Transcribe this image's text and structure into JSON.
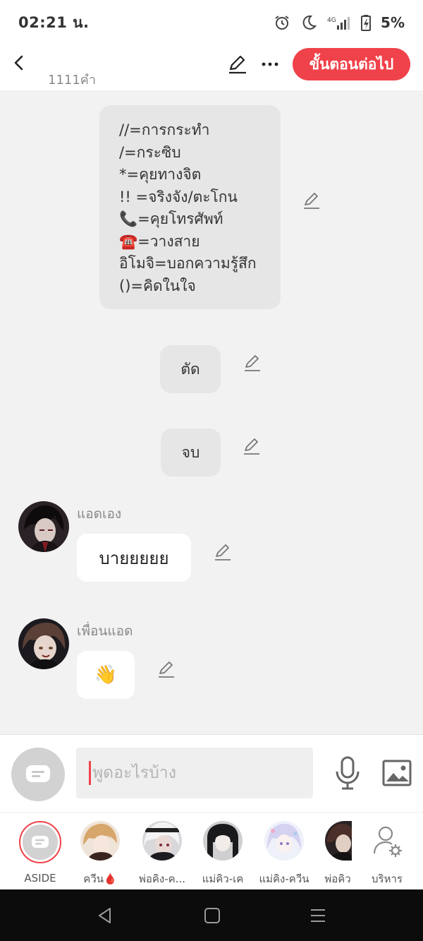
{
  "status_bar": {
    "time": "02:21 น.",
    "network": "4G",
    "battery": "5%"
  },
  "header": {
    "word_count": "1111คำ",
    "next_button": "ขั้นตอนต่อไป"
  },
  "messages": [
    {
      "type": "narration",
      "lines": [
        "//=การกระทำ",
        "/=กระซิบ",
        "*=คุยทางจิต",
        "!! =จริงจัง/ตะโกน",
        "📞=คุยโทรศัพท์",
        "☎️=วางสาย",
        "อิโมจิ=บอกความรู้สึก",
        "()=คิดในใจ"
      ]
    },
    {
      "type": "narration",
      "text": "ตัด"
    },
    {
      "type": "narration",
      "text": "จบ"
    },
    {
      "type": "character",
      "name": "แอดเอง",
      "text": "บายยยยย"
    },
    {
      "type": "character",
      "name": "เพื่อนแอด",
      "text": "👋"
    }
  ],
  "input": {
    "placeholder": "พูดอะไรบ้าง"
  },
  "characters": [
    {
      "label": "ASIDE",
      "avatar": "aside-icon"
    },
    {
      "label": "ควีน🩸",
      "avatar": "avatar-light-hair"
    },
    {
      "label": "พ่อคิง-ค...",
      "avatar": "avatar-white-hair"
    },
    {
      "label": "แม่คิว-เค",
      "avatar": "avatar-dark-hair"
    },
    {
      "label": "แม่คิง-ควีน",
      "avatar": "avatar-lavender-hair"
    },
    {
      "label": "พ่อคิว",
      "avatar": "avatar-brown-hair"
    },
    {
      "label": "บริหาร",
      "avatar": "manage-icon"
    }
  ],
  "colors": {
    "accent": "#f0424a",
    "background": "#f2f2f2",
    "narration_bubble": "#e6e6e6",
    "character_bubble": "#ffffff"
  }
}
